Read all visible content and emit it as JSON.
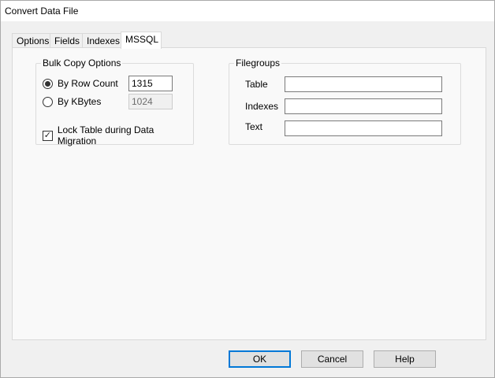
{
  "window": {
    "title": "Convert Data File"
  },
  "tabs": [
    {
      "label": "Options"
    },
    {
      "label": "Fields"
    },
    {
      "label": "Indexes"
    },
    {
      "label": "MSSQL",
      "active": true
    }
  ],
  "bulk_copy": {
    "legend": "Bulk Copy Options",
    "by_row_count": {
      "label": "By Row Count",
      "value": "1315",
      "selected": true
    },
    "by_kbytes": {
      "label": "By KBytes",
      "value": "1024",
      "selected": false,
      "disabled": true
    },
    "lock_table": {
      "label": "Lock Table during Data Migration",
      "checked": true
    }
  },
  "filegroups": {
    "legend": "Filegroups",
    "table": {
      "label": "Table",
      "value": ""
    },
    "indexes": {
      "label": "Indexes",
      "value": ""
    },
    "text": {
      "label": "Text",
      "value": ""
    }
  },
  "buttons": {
    "ok": "OK",
    "cancel": "Cancel",
    "help": "Help"
  }
}
